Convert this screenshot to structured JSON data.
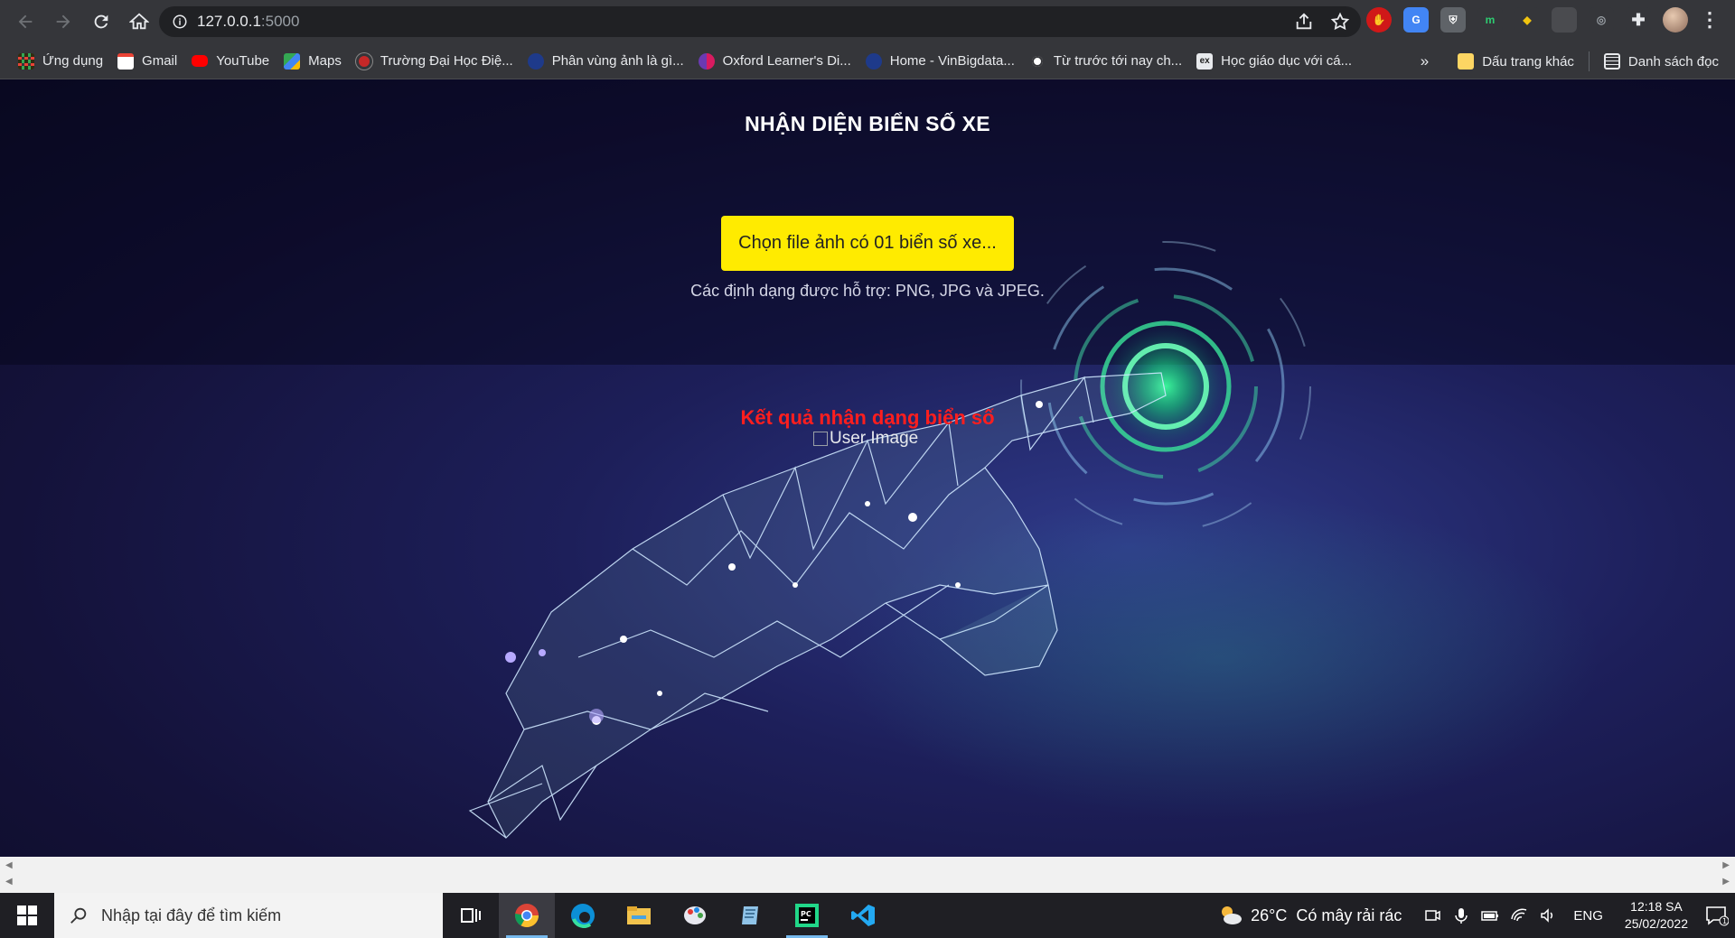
{
  "browser": {
    "url_host": "127.0.0.1",
    "url_port": ":5000",
    "bookmarks": [
      {
        "label": "Ứng dụng",
        "icon": "apps-grid-icon",
        "color": "#ea4335"
      },
      {
        "label": "Gmail",
        "icon": "gmail-icon",
        "color": "#ea4335"
      },
      {
        "label": "YouTube",
        "icon": "youtube-icon",
        "color": "#ff0000"
      },
      {
        "label": "Maps",
        "icon": "maps-icon",
        "color": "#34a853"
      },
      {
        "label": "Trường Đại Học Điệ...",
        "icon": "university-icon",
        "color": "#c62828"
      },
      {
        "label": "Phân vùng ảnh là gì...",
        "icon": "site-icon",
        "color": "#1e3a8a"
      },
      {
        "label": "Oxford Learner's Di...",
        "icon": "oxford-icon",
        "color": "#6a3ab2"
      },
      {
        "label": "Home - VinBigdata...",
        "icon": "vinbigdata-icon",
        "color": "#1e3a8a"
      },
      {
        "label": "Từ trước tới nay ch...",
        "icon": "globe-icon",
        "color": "#ffffff"
      },
      {
        "label": "Học giáo dục với cá...",
        "icon": "edx-icon",
        "color": "#222222"
      }
    ],
    "more_bookmarks": "»",
    "other_bookmarks": "Dấu trang khác",
    "reading_list": "Danh sách đọc"
  },
  "page": {
    "title": "NHẬN DIỆN BIỂN SỐ XE",
    "upload_button": "Chọn file ảnh có 01 biển số xe...",
    "formats_note": "Các định dạng được hỗ trợ: PNG, JPG và JPEG.",
    "result_title": "Kết quả nhận dạng biển số",
    "user_image_alt": "User Image",
    "colors": {
      "button": "#ffeb00",
      "result": "#ff1e1e",
      "title": "#ffffff"
    }
  },
  "taskbar": {
    "search_placeholder": "Nhập tại đây để tìm kiếm",
    "apps": [
      "task-view-icon",
      "chrome-icon",
      "edge-icon",
      "file-explorer-icon",
      "paint-icon",
      "notepad-icon",
      "pycharm-icon",
      "vscode-icon"
    ],
    "weather_temp": "26°C",
    "weather_text": "Có mây rải rác",
    "language": "ENG",
    "time": "12:18 SA",
    "date": "25/02/2022",
    "notification_count": "1"
  }
}
